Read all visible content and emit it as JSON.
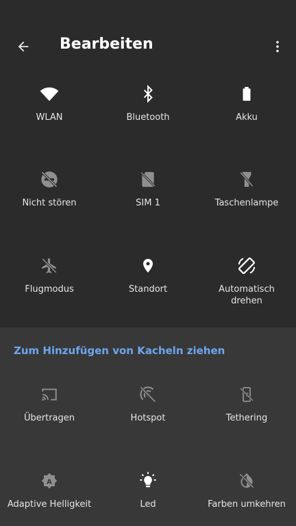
{
  "header": {
    "title": "Bearbeiten"
  },
  "active_tiles": [
    {
      "label": "WLAN",
      "icon": "wifi-icon"
    },
    {
      "label": "Bluetooth",
      "icon": "bluetooth-icon"
    },
    {
      "label": "Akku",
      "icon": "battery-icon"
    },
    {
      "label": "Nicht stören",
      "icon": "do-not-disturb-icon"
    },
    {
      "label": "SIM 1",
      "icon": "sim-off-icon"
    },
    {
      "label": "Taschenlampe",
      "icon": "flashlight-off-icon"
    },
    {
      "label": "Flugmodus",
      "icon": "airplane-off-icon"
    },
    {
      "label": "Standort",
      "icon": "location-icon"
    },
    {
      "label": "Automatisch drehen",
      "icon": "auto-rotate-icon"
    }
  ],
  "available_section": {
    "hint": "Zum Hinzufügen von Kacheln ziehen"
  },
  "available_tiles": [
    {
      "label": "Übertragen",
      "icon": "cast-icon"
    },
    {
      "label": "Hotspot",
      "icon": "hotspot-off-icon"
    },
    {
      "label": "Tethering",
      "icon": "tethering-off-icon"
    },
    {
      "label": "Adaptive Helligkeit",
      "icon": "adaptive-brightness-icon"
    },
    {
      "label": "Led",
      "icon": "led-bulb-icon"
    },
    {
      "label": "Farben umkehren",
      "icon": "invert-colors-off-icon"
    }
  ],
  "colors": {
    "background": "#2b2b2b",
    "tray_background": "#383838",
    "accent": "#6ea6ee",
    "icon_active": "#ffffff",
    "icon_inactive": "#8f8f8f"
  }
}
